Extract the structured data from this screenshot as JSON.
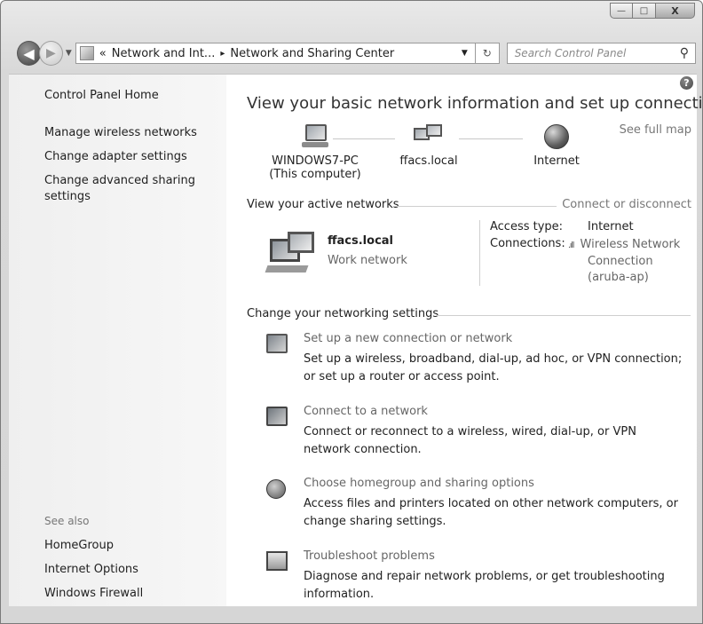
{
  "window": {
    "min": "—",
    "max": "□",
    "close": "X"
  },
  "nav": {
    "back": "◀",
    "forward": "▶",
    "history_drop": "▼",
    "breadcrumb": [
      "«",
      "Network and Int...",
      "▸",
      "Network and Sharing Center"
    ],
    "addr_drop": "▼",
    "refresh": "↻",
    "search_placeholder": "Search Control Panel",
    "search_icon": "⚲"
  },
  "sidebar": {
    "home": "Control Panel Home",
    "links": [
      "Manage wireless networks",
      "Change adapter settings",
      "Change advanced sharing settings"
    ],
    "see_also": "See also",
    "see_also_links": [
      "HomeGroup",
      "Internet Options",
      "Windows Firewall"
    ]
  },
  "main": {
    "help": "?",
    "title": "View your basic network information and set up connections",
    "map": {
      "computer": "WINDOWS7-PC",
      "computer_sub": "(This computer)",
      "network": "ffacs.local",
      "internet": "Internet",
      "full_map": "See full map"
    },
    "active": {
      "heading": "View your active networks",
      "connect_link": "Connect or disconnect",
      "name": "ffacs.local",
      "type": "Work network",
      "access_label": "Access type:",
      "access_value": "Internet",
      "conn_label": "Connections:",
      "conn_link_1": "Wireless Network",
      "conn_link_2": "Connection",
      "conn_link_3": "(aruba-ap)"
    },
    "settings": {
      "heading": "Change your networking settings",
      "tasks": [
        {
          "title": "Set up a new connection or network",
          "desc": "Set up a wireless, broadband, dial-up, ad hoc, or VPN connection; or set up a router or access point."
        },
        {
          "title": "Connect to a network",
          "desc": "Connect or reconnect to a wireless, wired, dial-up, or VPN network connection."
        },
        {
          "title": "Choose homegroup and sharing options",
          "desc": "Access files and printers located on other network computers, or change sharing settings."
        },
        {
          "title": "Troubleshoot problems",
          "desc": "Diagnose and repair network problems, or get troubleshooting information."
        }
      ]
    }
  }
}
